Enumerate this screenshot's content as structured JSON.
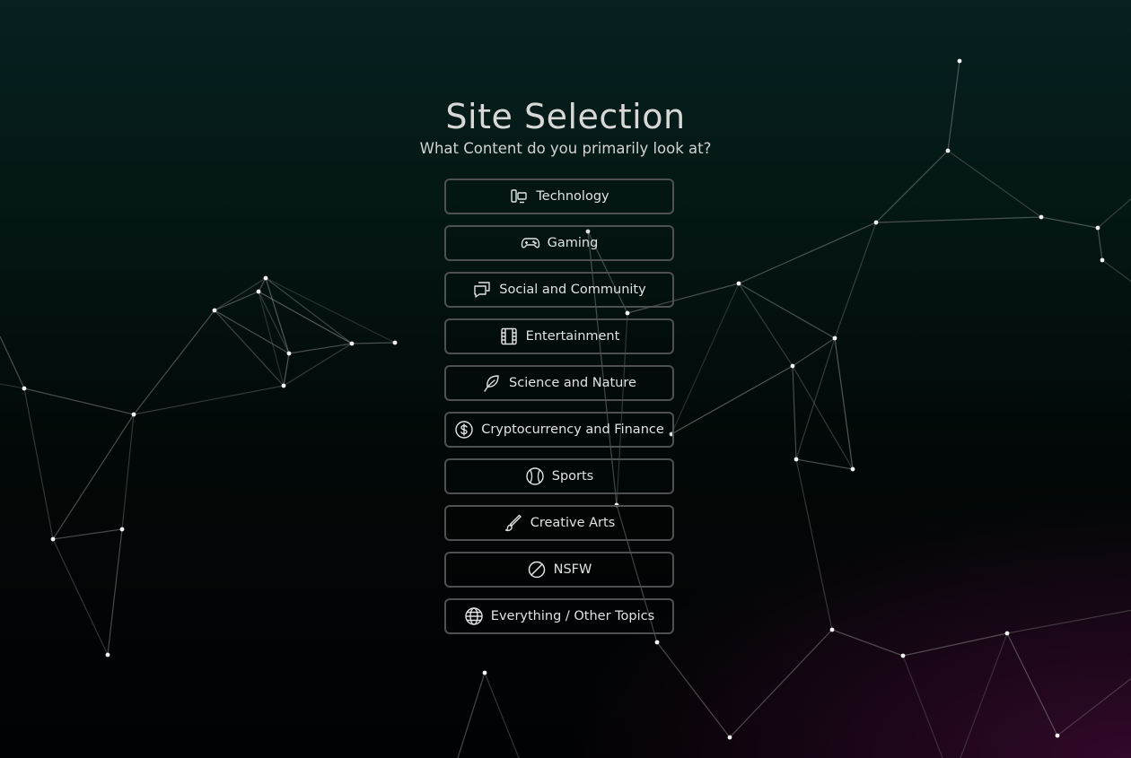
{
  "header": {
    "title": "Site Selection",
    "subtitle": "What Content do you primarily look at?"
  },
  "options": [
    {
      "label": "Technology",
      "icon": "devices-icon"
    },
    {
      "label": "Gaming",
      "icon": "gamepad-icon"
    },
    {
      "label": "Social and Community",
      "icon": "chat-bubbles-icon"
    },
    {
      "label": "Entertainment",
      "icon": "film-icon"
    },
    {
      "label": "Science and Nature",
      "icon": "leaf-icon"
    },
    {
      "label": "Cryptocurrency and Finance",
      "icon": "dollar-coin-icon"
    },
    {
      "label": "Sports",
      "icon": "ball-icon"
    },
    {
      "label": "Creative Arts",
      "icon": "brush-icon"
    },
    {
      "label": "NSFW",
      "icon": "prohibited-icon"
    },
    {
      "label": "Everything / Other Topics",
      "icon": "globe-icon"
    }
  ],
  "colors": {
    "button_border": "#4e5150",
    "text": "#e2e2e2",
    "network_line": "#9a9a9a",
    "network_node": "#f2f2f2"
  }
}
